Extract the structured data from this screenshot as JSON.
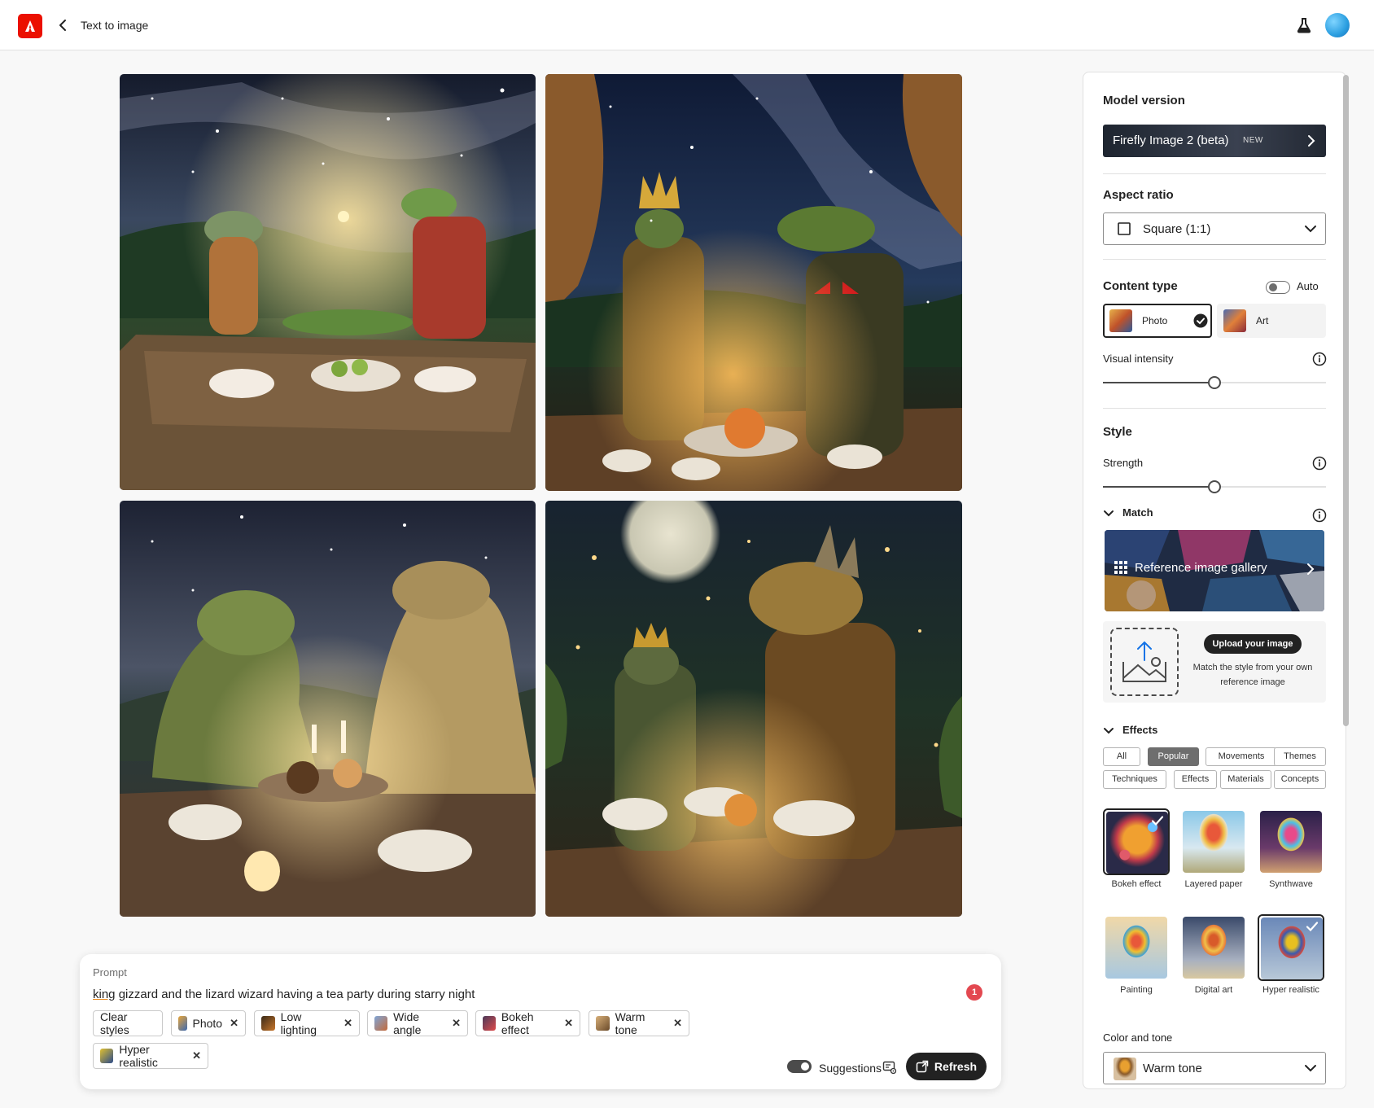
{
  "header": {
    "title": "Text to image"
  },
  "prompt": {
    "label": "Prompt",
    "text_underlined": "king",
    "text_rest": " gizzard and the lizard wizard having a tea party during starry night",
    "badge_count": "1",
    "chips": [
      {
        "label": "Clear styles"
      },
      {
        "label": "Photo"
      },
      {
        "label": "Low lighting"
      },
      {
        "label": "Wide angle"
      },
      {
        "label": "Bokeh effect"
      },
      {
        "label": "Warm tone"
      },
      {
        "label": "Hyper realistic"
      }
    ],
    "suggestions_label": "Suggestions",
    "suggestions_on": true,
    "refresh_label": "Refresh"
  },
  "panel": {
    "model_heading": "Model version",
    "model_value": "Firefly Image 2 (beta)",
    "model_badge": "NEW",
    "aspect_heading": "Aspect ratio",
    "aspect_value": "Square (1:1)",
    "content_heading": "Content type",
    "auto_label": "Auto",
    "auto_on": false,
    "content_types": [
      {
        "label": "Photo",
        "selected": true
      },
      {
        "label": "Art",
        "selected": false
      }
    ],
    "visual_intensity_label": "Visual intensity",
    "visual_intensity_value": 0.5,
    "style_heading": "Style",
    "strength_label": "Strength",
    "strength_value": 0.5,
    "match_label": "Match",
    "gallery_label": "Reference image gallery",
    "upload_button": "Upload your image",
    "upload_desc": "Match the style from your own reference image",
    "effects_label": "Effects",
    "effect_tabs": [
      "All",
      "Popular",
      "Movements",
      "Themes",
      "Techniques",
      "Effects",
      "Materials",
      "Concepts"
    ],
    "effect_tab_selected": "Popular",
    "effect_tiles": [
      {
        "label": "Bokeh effect",
        "selected": true
      },
      {
        "label": "Layered paper",
        "selected": false
      },
      {
        "label": "Synthwave",
        "selected": false
      },
      {
        "label": "Painting",
        "selected": false
      },
      {
        "label": "Digital art",
        "selected": false
      },
      {
        "label": "Hyper realistic",
        "selected": true
      }
    ],
    "color_tone_label": "Color and tone",
    "color_tone_value": "Warm tone"
  },
  "colors": {
    "accent": "#eb1000",
    "dark": "#222222",
    "badge": "#e34850"
  }
}
